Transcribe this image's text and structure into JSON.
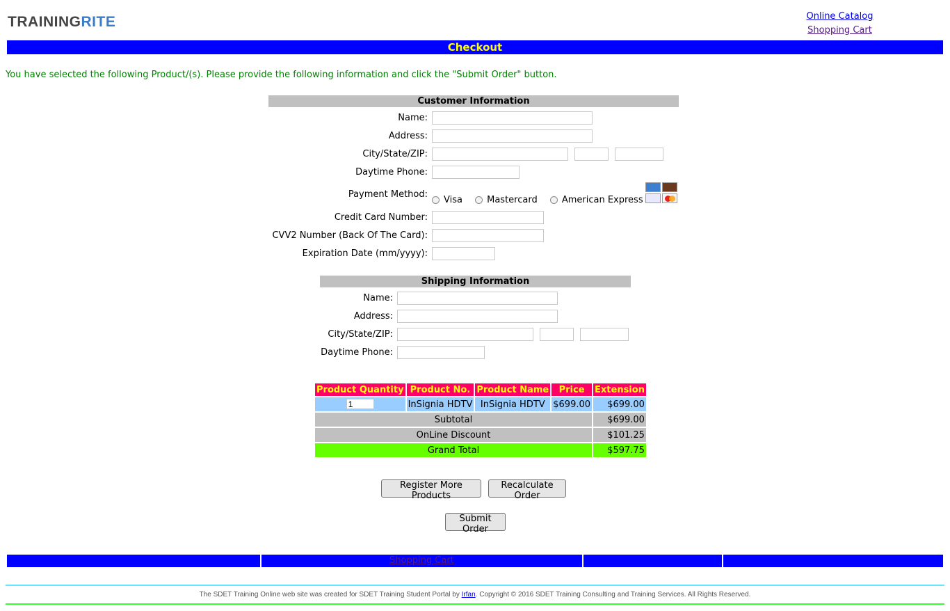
{
  "header": {
    "logo_part1": "TRAINING",
    "logo_part2": "RITE",
    "link_catalog": "Online Catalog",
    "link_cart": "Shopping Cart"
  },
  "banner": {
    "title": "Checkout"
  },
  "intro": "You have selected the following Product/(s). Please provide the following information and click the \"Submit Order\" button.",
  "customer": {
    "heading": "Customer Information",
    "name_label": "Name:",
    "address_label": "Address:",
    "city_label": "City/State/ZIP:",
    "phone_label": "Daytime Phone:",
    "payment_label": "Payment Method:",
    "payment_options": [
      "Visa",
      "Mastercard",
      "American Express"
    ],
    "cc_number_label": "Credit Card Number:",
    "cvv_label": "CVV2 Number (Back Of The Card):",
    "expiry_label": "Expiration Date (mm/yyyy):"
  },
  "shipping": {
    "heading": "Shipping Information",
    "name_label": "Name:",
    "address_label": "Address:",
    "city_label": "City/State/ZIP:",
    "phone_label": "Daytime Phone:"
  },
  "order_table": {
    "headers": [
      "Product Quantity",
      "Product No.",
      "Product Name",
      "Price",
      "Extension"
    ],
    "row": {
      "quantity": "1",
      "product_no": "InSignia HDTV",
      "product_name": "InSignia HDTV",
      "price": "$699.00",
      "extension": "$699.00"
    },
    "subtotal_label": "Subtotal",
    "subtotal_value": "$699.00",
    "discount_label": "OnLine Discount",
    "discount_value": "$101.25",
    "grand_total_label": "Grand Total",
    "grand_total_value": "$597.75"
  },
  "buttons": {
    "register_more": "Register More Products",
    "recalculate": "Recalculate Order",
    "submit": "Submit Order"
  },
  "footer": {
    "cart_link": "Shopping Cart",
    "note_before": "The SDET Training Online web site was created for SDET Training Student Portal by ",
    "note_author": "Irfan",
    "note_after": ". Copyright © 2016 SDET Training Consulting and Training Services. All Rights Reserved."
  },
  "colors": {
    "banner_bg": "#0000ff",
    "banner_text": "#ffff00",
    "table_header_bg": "#ff0066",
    "row_item_bg": "#99ccff",
    "row_total_bg": "#c0c0c0",
    "grand_total_bg": "#66ff00",
    "intro_text": "#008000"
  }
}
